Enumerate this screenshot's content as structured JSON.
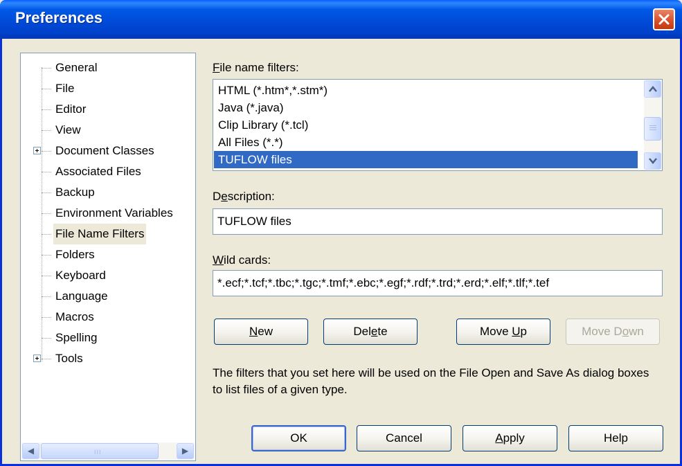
{
  "window": {
    "title": "Preferences"
  },
  "tree": {
    "items": [
      {
        "label": "General",
        "expandable": false
      },
      {
        "label": "File",
        "expandable": false
      },
      {
        "label": "Editor",
        "expandable": false
      },
      {
        "label": "View",
        "expandable": false
      },
      {
        "label": "Document Classes",
        "expandable": true
      },
      {
        "label": "Associated Files",
        "expandable": false
      },
      {
        "label": "Backup",
        "expandable": false
      },
      {
        "label": "Environment Variables",
        "expandable": false
      },
      {
        "label": "File Name Filters",
        "expandable": false,
        "selected": true
      },
      {
        "label": "Folders",
        "expandable": false
      },
      {
        "label": "Keyboard",
        "expandable": false
      },
      {
        "label": "Language",
        "expandable": false
      },
      {
        "label": "Macros",
        "expandable": false
      },
      {
        "label": "Spelling",
        "expandable": false
      },
      {
        "label": "Tools",
        "expandable": true
      }
    ],
    "scroll_grip": "III"
  },
  "filters": {
    "label_prefix": "F",
    "label_rest": "ile name filters:",
    "items": [
      "HTML (*.htm*,*.stm*)",
      "Java (*.java)",
      "Clip Library (*.tcl)",
      "All Files (*.*)",
      "TUFLOW files"
    ],
    "selected_index": 4
  },
  "description": {
    "label_pre": "D",
    "label_key": "e",
    "label_rest": "scription:",
    "value": "TUFLOW files"
  },
  "wildcards": {
    "label_key": "W",
    "label_rest": "ild cards:",
    "value": "*.ecf;*.tcf;*.tbc;*.tgc;*.tmf;*.ebc;*.egf;*.rdf;*.trd;*.erd;*.elf;*.tlf;*.tef"
  },
  "actions": {
    "new": {
      "key": "N",
      "rest": "ew"
    },
    "delete": {
      "pre": "Del",
      "key": "e",
      "rest": "te"
    },
    "move_up": {
      "pre": "Move ",
      "key": "U",
      "rest": "p"
    },
    "move_down": {
      "pre": "Move D",
      "key": "o",
      "rest": "wn"
    }
  },
  "help_text": "The filters that you set here will be used on the File Open and Save As dialog boxes to list files of a given type.",
  "footer": {
    "ok": "OK",
    "cancel": "Cancel",
    "apply": {
      "key": "A",
      "rest": "pply"
    },
    "help": "Help"
  },
  "colors": {
    "titlebar": "#0054e3",
    "selection": "#316ac5",
    "dialog_bg": "#ece9d8",
    "close_button": "#d9522b"
  },
  "icons": [
    "close-icon",
    "expand-icon",
    "scroll-up-icon",
    "scroll-down-icon",
    "scroll-left-icon",
    "scroll-right-icon"
  ]
}
